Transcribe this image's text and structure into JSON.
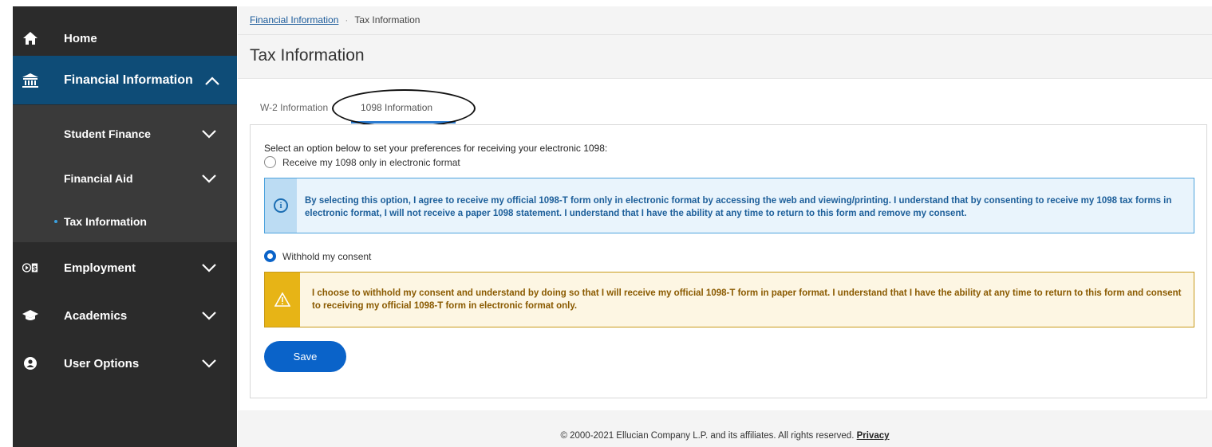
{
  "sidebar": {
    "home": {
      "label": "Home",
      "icon": "home-icon"
    },
    "financial_information": {
      "label": "Financial Information",
      "icon": "bank-icon",
      "expanded": true,
      "active_color": "#0e4c77"
    },
    "sub_items": [
      {
        "label": "Student Finance"
      },
      {
        "label": "Financial Aid"
      },
      {
        "label": "Tax Information",
        "active": true
      }
    ],
    "employment": {
      "label": "Employment",
      "icon": "employment-icon"
    },
    "academics": {
      "label": "Academics",
      "icon": "graduation-cap-icon"
    },
    "user_options": {
      "label": "User Options",
      "icon": "user-icon"
    }
  },
  "breadcrumb": {
    "parent": "Financial Information",
    "current": "Tax Information"
  },
  "page_title": "Tax Information",
  "tabs": [
    {
      "label": "W-2 Information"
    },
    {
      "label": "1098 Information",
      "active": true
    }
  ],
  "form": {
    "prompt": "Select an option below to set your preferences for receiving your electronic 1098:",
    "option_electronic": {
      "label": "Receive my 1098 only in electronic format",
      "selected": false
    },
    "info_message": "By selecting this option, I agree to receive my official 1098-T form only in electronic format by accessing the web and viewing/printing. I understand that by consenting to receive my 1098 tax forms in electronic format, I will not receive a paper 1098 statement. I understand that I have the ability at any time to return to this form and remove my consent.",
    "option_withhold": {
      "label": "Withhold my consent",
      "selected": true
    },
    "warning_message": "I choose to withhold my consent and understand by doing so that I will receive my official 1098-T form in paper format. I understand that I have the ability at any time to return to this form and consent to receiving my official 1098-T form in electronic format only.",
    "save_label": "Save"
  },
  "footer": {
    "copyright": "© 2000-2021 Ellucian Company L.P. and its affiliates. All rights reserved.",
    "privacy_label": "Privacy"
  },
  "colors": {
    "primary": "#0a63c9",
    "sidebar": "#2b2b2b",
    "info": "#4ea3dd",
    "warning": "#e7b416"
  }
}
